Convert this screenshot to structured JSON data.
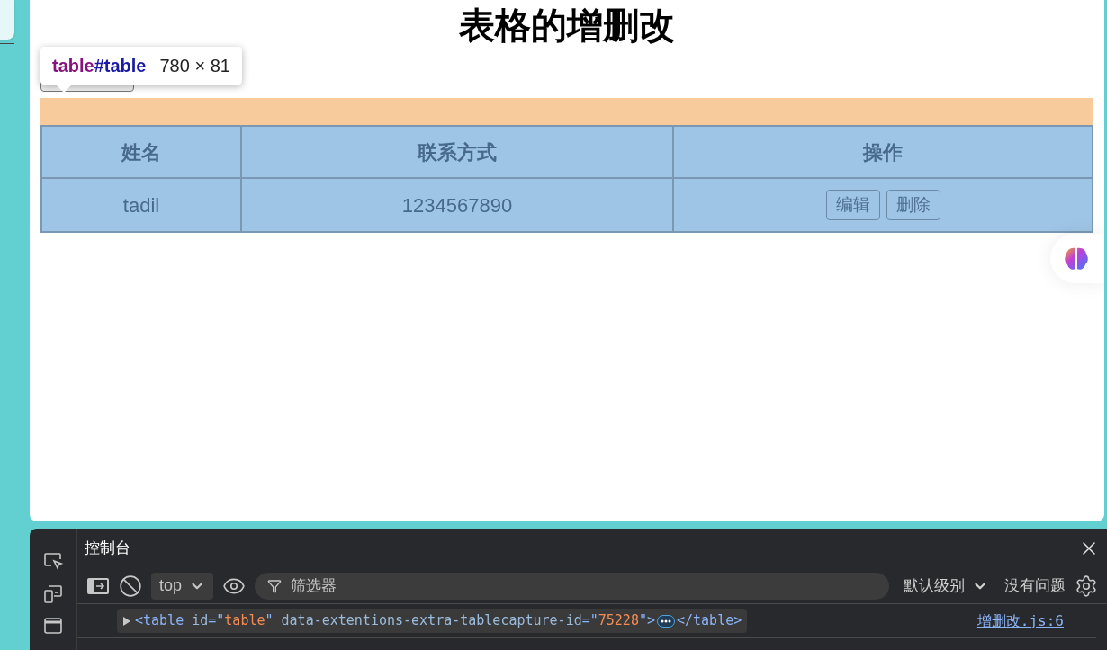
{
  "page": {
    "title": "表格的增删改"
  },
  "tooltip": {
    "selector_tag": "table",
    "selector_id": "#table",
    "size": "780 × 81"
  },
  "table": {
    "columns": [
      "姓名",
      "联系方式",
      "操作"
    ],
    "rows": [
      {
        "name": "tadil",
        "contact": "1234567890",
        "actions": [
          "编辑",
          "删除"
        ]
      }
    ]
  },
  "devtools": {
    "tab": "控制台",
    "context": "top",
    "filter_placeholder": "筛选器",
    "level": "默认级别",
    "issues": "没有问题",
    "log": {
      "parts": [
        {
          "kind": "punct",
          "text": "<"
        },
        {
          "kind": "tag",
          "text": "table"
        },
        {
          "kind": "attr",
          "text": " id"
        },
        {
          "kind": "punct",
          "text": "=\""
        },
        {
          "kind": "value",
          "text": "table"
        },
        {
          "kind": "punct",
          "text": "\""
        },
        {
          "kind": "attr",
          "text": " data-extentions-extra-tablecapture-id"
        },
        {
          "kind": "punct",
          "text": "=\""
        },
        {
          "kind": "value",
          "text": "75228"
        },
        {
          "kind": "punct",
          "text": "\">"
        }
      ],
      "close_tag": "</table>",
      "source": "增删改.js:6"
    }
  }
}
